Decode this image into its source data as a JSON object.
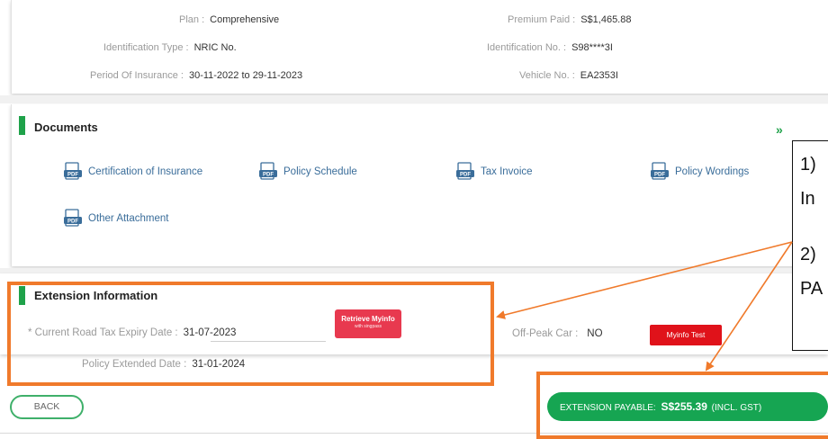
{
  "policy": {
    "plan": {
      "label": "Plan :",
      "value": "Comprehensive"
    },
    "premium_paid": {
      "label": "Premium Paid :",
      "value": "S$1,465.88"
    },
    "id_type": {
      "label": "Identification Type :",
      "value": "NRIC No."
    },
    "id_no": {
      "label": "Identification No. :",
      "value": "S98****3I"
    },
    "period": {
      "label": "Period Of Insurance :",
      "value": "30-11-2022 to 29-11-2023"
    },
    "vehicle_no": {
      "label": "Vehicle No. :",
      "value": "EA2353I"
    }
  },
  "documents": {
    "title": "Documents",
    "items": [
      {
        "label": "Certification of Insurance"
      },
      {
        "label": "Policy Schedule"
      },
      {
        "label": "Tax Invoice"
      },
      {
        "label": "Policy Wordings"
      },
      {
        "label": "Other Attachment"
      }
    ]
  },
  "extension": {
    "title": "Extension Information",
    "road_tax": {
      "label": "* Current Road Tax Expiry Date :",
      "value": "31-07-2023"
    },
    "retrieve_button": {
      "line1": "Retrieve Myinfo",
      "line2": "with singpass"
    },
    "off_peak": {
      "label": "Off-Peak Car :",
      "value": "NO"
    },
    "myinfo_test_label": "Myinfo Test",
    "policy_extended": {
      "label": "Policy Extended Date :",
      "value": "31-01-2024"
    }
  },
  "footer": {
    "back_label": "BACK",
    "payable": {
      "label": "EXTENSION PAYABLE:",
      "amount": "S$255.39",
      "suffix": "(INCL. GST)"
    }
  },
  "annotation": {
    "line1": "1)",
    "line2": "In",
    "line3": "2)",
    "line4": "PA"
  },
  "colors": {
    "accent_green": "#1fa24a",
    "callout_orange": "#f07a2b",
    "myinfo_red": "#e8394f"
  }
}
